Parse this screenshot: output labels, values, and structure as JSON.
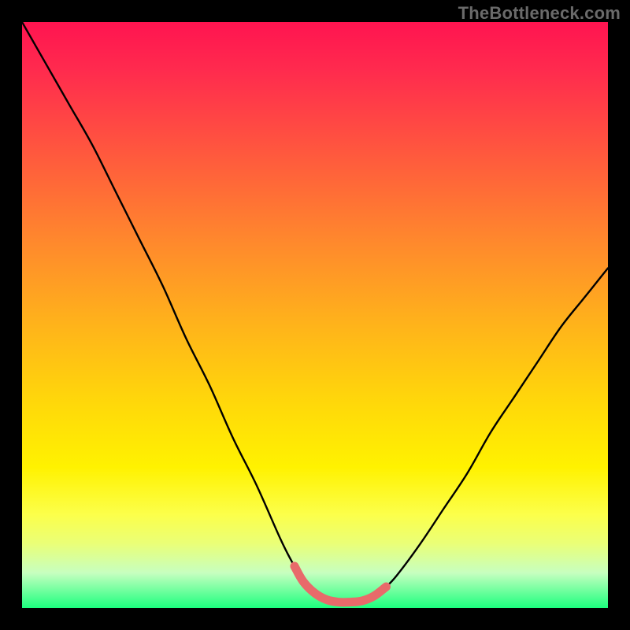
{
  "attribution": "TheBottleneck.com",
  "chart_data": {
    "type": "line",
    "title": "",
    "xlabel": "",
    "ylabel": "",
    "xlim": [
      0,
      100
    ],
    "ylim": [
      0,
      100
    ],
    "grid": false,
    "curve_points": [
      {
        "x": 0,
        "y": 100
      },
      {
        "x": 4,
        "y": 93
      },
      {
        "x": 8,
        "y": 86
      },
      {
        "x": 12,
        "y": 79
      },
      {
        "x": 16,
        "y": 71
      },
      {
        "x": 20,
        "y": 63
      },
      {
        "x": 24,
        "y": 55
      },
      {
        "x": 28,
        "y": 46
      },
      {
        "x": 32,
        "y": 38
      },
      {
        "x": 36,
        "y": 29
      },
      {
        "x": 40,
        "y": 21
      },
      {
        "x": 44,
        "y": 12
      },
      {
        "x": 46,
        "y": 8
      },
      {
        "x": 48,
        "y": 4.5
      },
      {
        "x": 50,
        "y": 2.5
      },
      {
        "x": 52,
        "y": 1.4
      },
      {
        "x": 54,
        "y": 1
      },
      {
        "x": 56,
        "y": 1
      },
      {
        "x": 58,
        "y": 1.2
      },
      {
        "x": 60,
        "y": 2
      },
      {
        "x": 62,
        "y": 3.5
      },
      {
        "x": 64,
        "y": 5.6
      },
      {
        "x": 68,
        "y": 11
      },
      {
        "x": 72,
        "y": 17
      },
      {
        "x": 76,
        "y": 23
      },
      {
        "x": 80,
        "y": 30
      },
      {
        "x": 84,
        "y": 36
      },
      {
        "x": 88,
        "y": 42
      },
      {
        "x": 92,
        "y": 48
      },
      {
        "x": 96,
        "y": 53
      },
      {
        "x": 100,
        "y": 58
      }
    ],
    "highlight_range_x": [
      46.5,
      62
    ],
    "gradient_stops": [
      {
        "pos": 0.0,
        "color": "#ff1450"
      },
      {
        "pos": 0.5,
        "color": "#ffb41a"
      },
      {
        "pos": 0.8,
        "color": "#fff200"
      },
      {
        "pos": 1.0,
        "color": "#1cff7e"
      }
    ]
  }
}
